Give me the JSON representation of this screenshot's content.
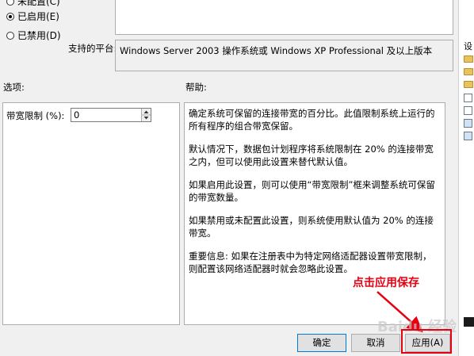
{
  "state": {
    "not_configured_label": "未配置(C)",
    "enabled_label": "已启用(E)",
    "disabled_label": "已禁用(D)"
  },
  "platform": {
    "label": "支持的平台:",
    "value": "Windows Server 2003 操作系统或 Windows XP Professional 及以上版本"
  },
  "options": {
    "title": "选项:",
    "bandwidth_label": "带宽限制 (%):",
    "bandwidth_value": "0"
  },
  "help": {
    "title": "帮助:",
    "paragraphs": [
      "确定系统可保留的连接带宽的百分比。此值限制系统上运行的所有程序的组合带宽保留。",
      "默认情况下，数据包计划程序将系统限制在 20% 的连接带宽之内，但可以使用此设置来替代默认值。",
      "如果启用此设置，则可以使用“带宽限制”框来调整系统可保留的带宽数量。",
      "如果禁用或未配置此设置，则系统使用默认值为 20% 的连接带宽。",
      "重要信息: 如果在注册表中为特定网络适配器设置带宽限制，则配置该网络适配器时就会忽略此设置。"
    ]
  },
  "annotation": {
    "text": "点击应用保存",
    "color": "#e60012"
  },
  "buttons": {
    "ok": "确定",
    "cancel": "取消",
    "apply": "应用(A)"
  },
  "right_strip": {
    "label": "设"
  },
  "watermark": "Baidu 经验"
}
